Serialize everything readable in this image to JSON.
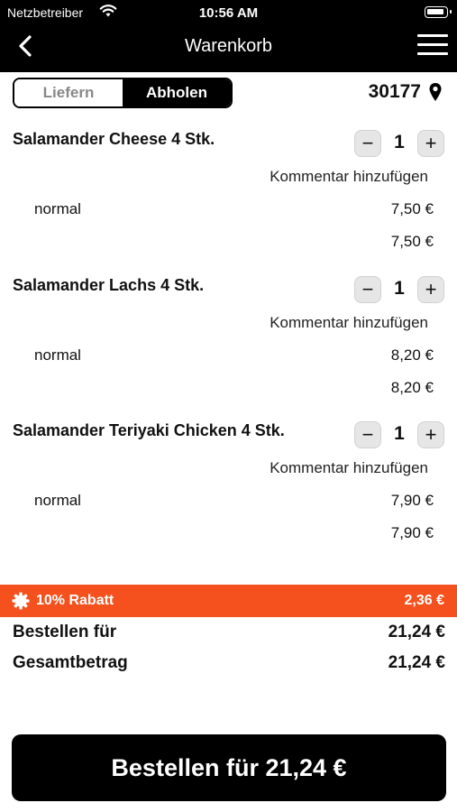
{
  "status": {
    "carrier": "Netzbetreiber",
    "time": "10:56 AM"
  },
  "header": {
    "title": "Warenkorb",
    "back_icon": "chevron-left-icon",
    "menu_icon": "hamburger-menu-icon"
  },
  "mode": {
    "options": [
      "Liefern",
      "Abholen"
    ],
    "selected": "Abholen"
  },
  "location": {
    "zip": "30177",
    "icon": "map-pin-icon"
  },
  "items": [
    {
      "name": "Salamander Cheese 4 Stk.",
      "qty": "1",
      "comment": "Kommentar hinzufügen",
      "variant": "normal",
      "variant_price": "7,50 €",
      "subtotal": "7,50 €"
    },
    {
      "name": "Salamander Lachs 4 Stk.",
      "qty": "1",
      "comment": "Kommentar hinzufügen",
      "variant": "normal",
      "variant_price": "8,20 €",
      "subtotal": "8,20 €"
    },
    {
      "name": "Salamander Teriyaki Chicken 4 Stk.",
      "qty": "1",
      "comment": "Kommentar hinzufügen",
      "variant": "normal",
      "variant_price": "7,90 €",
      "subtotal": "7,90 €"
    }
  ],
  "stepper": {
    "minus": "−",
    "plus": "+"
  },
  "discount": {
    "label": "10% Rabatt",
    "amount": "2,36 €",
    "color": "#f4511e"
  },
  "summary": {
    "order_for_label": "Bestellen für",
    "order_for_value": "21,24 €",
    "total_label": "Gesamtbetrag",
    "total_value": "21,24 €"
  },
  "order_button": {
    "label": "Bestellen für 21,24 €"
  }
}
